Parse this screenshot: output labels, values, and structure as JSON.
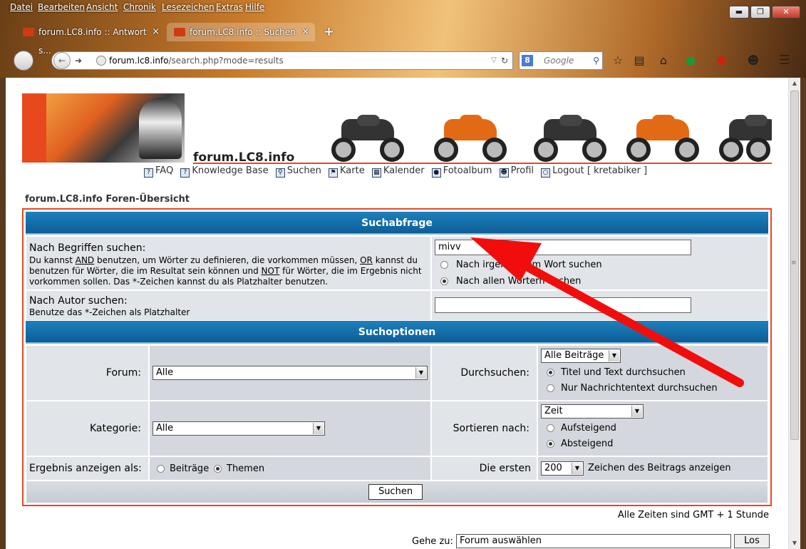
{
  "menu": [
    "Datei",
    "Bearbeiten",
    "Ansicht",
    "Chronik",
    "Lesezeichen",
    "Extras",
    "Hilfe"
  ],
  "tabs": [
    {
      "label": "forum.LC8.info :: Antwort s...",
      "close": "×"
    },
    {
      "label": "forum.LC8.info :: Suchen",
      "close": "×"
    }
  ],
  "new_tab": "+",
  "window_buttons": {
    "minimize": "▬",
    "maximize": "❐",
    "close": "✕"
  },
  "address": {
    "host": "forum.lc8.info",
    "path": "/search.php?mode=results"
  },
  "search_engine": {
    "placeholder": "Google",
    "badge": "8"
  },
  "site": {
    "title": "forum.LC8.info",
    "nav": [
      {
        "icon": "question-icon",
        "label": "FAQ"
      },
      {
        "icon": "question-icon",
        "label": "Knowledge Base"
      },
      {
        "icon": "search-icon",
        "label": "Suchen"
      },
      {
        "icon": "flag-icon",
        "label": "Karte"
      },
      {
        "icon": "calendar-icon",
        "label": "Kalender"
      },
      {
        "icon": "camera-icon",
        "label": "Fotoalbum"
      },
      {
        "icon": "profile-icon",
        "label": "Profil"
      },
      {
        "icon": "logout-icon",
        "label": "Logout [ kretabiker ]"
      }
    ],
    "breadcrumb": "forum.LC8.info Foren-Übersicht"
  },
  "query": {
    "caption": "Suchabfrage",
    "terms_label": "Nach Begriffen suchen:",
    "terms_hint_1": "Du kannst ",
    "terms_hint_and": "AND",
    "terms_hint_2": " benutzen, um Wörter zu definieren, die vorkommen müssen, ",
    "terms_hint_or": "OR",
    "terms_hint_3": " kannst du benutzen für Wörter, die im Resultat sein können und ",
    "terms_hint_not": "NOT",
    "terms_hint_4": " für Wörter, die im Ergebnis nicht vorkommen sollen. Das *-Zeichen kannst du als Platzhalter benutzen.",
    "terms_value": "mivv",
    "mode_any": "Nach irgendeinem Wort suchen",
    "mode_all": "Nach allen Wörtern suchen",
    "author_label": "Nach Autor suchen:",
    "author_hint": "Benutze das *-Zeichen als Platzhalter",
    "author_value": ""
  },
  "options": {
    "caption": "Suchoptionen",
    "forum_label": "Forum:",
    "forum_value": "Alle",
    "search_in_label": "Durchsuchen:",
    "search_in_value": "Alle Beiträge",
    "search_title_text": "Titel und Text durchsuchen",
    "search_text_only": "Nur Nachrichtentext durchsuchen",
    "category_label": "Kategorie:",
    "category_value": "Alle",
    "sort_label": "Sortieren nach:",
    "sort_value": "Zeit",
    "sort_asc": "Aufsteigend",
    "sort_desc": "Absteigend",
    "show_as_label": "Ergebnis anzeigen als:",
    "show_posts": "Beiträge",
    "show_topics": "Themen",
    "first_label": "Die ersten",
    "first_value": "200",
    "first_suffix": "Zeichen des Beitrags anzeigen",
    "submit": "Suchen"
  },
  "footer": {
    "timezone": "Alle Zeiten sind GMT + 1 Stunde",
    "goto_label": "Gehe zu:",
    "goto_value": "Forum auswählen",
    "goto_button": "Los"
  },
  "colors": {
    "accent": "#e8481e",
    "header_blue": "#0d5d96",
    "annotation_arrow": "#f20d0d"
  }
}
